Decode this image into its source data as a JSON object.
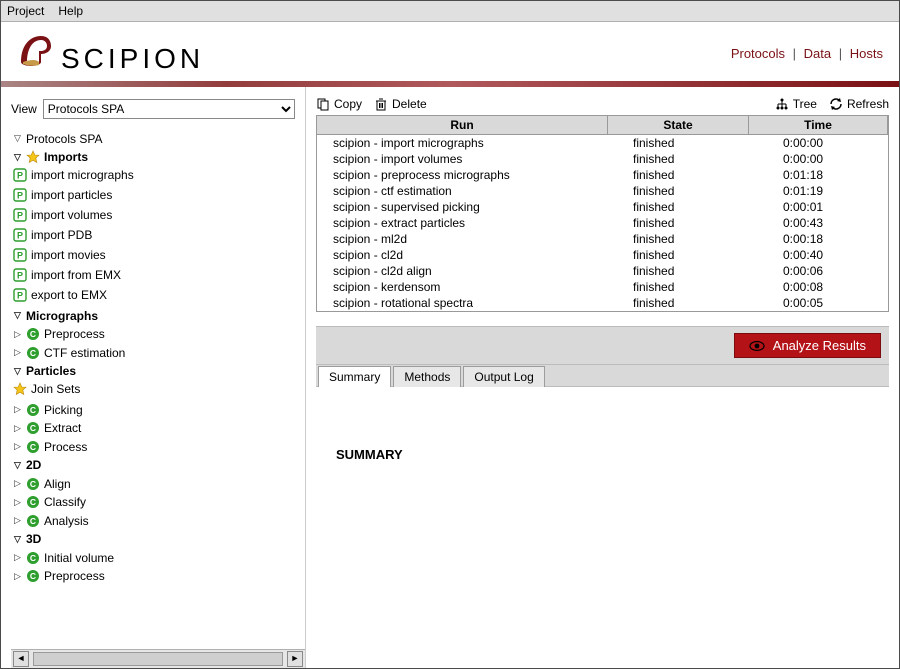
{
  "menu": {
    "project": "Project",
    "help": "Help"
  },
  "brand": "SCIPION",
  "header_links": {
    "protocols": "Protocols",
    "data": "Data",
    "hosts": "Hosts"
  },
  "view_label": "View",
  "view_value": "Protocols SPA",
  "tree": {
    "root": "Protocols SPA",
    "imports": {
      "label": "Imports",
      "items": [
        "import micrographs",
        "import particles",
        "import volumes",
        "import PDB",
        "import movies",
        "import from EMX",
        "export to EMX"
      ]
    },
    "micrographs": {
      "label": "Micrographs",
      "items": [
        "Preprocess",
        "CTF estimation"
      ]
    },
    "particles": {
      "label": "Particles",
      "join": "Join Sets",
      "items": [
        "Picking",
        "Extract",
        "Process"
      ]
    },
    "two_d": {
      "label": "2D",
      "items": [
        "Align",
        "Classify",
        "Analysis"
      ]
    },
    "three_d": {
      "label": "3D",
      "items": [
        "Initial volume",
        "Preprocess"
      ]
    }
  },
  "toolbar": {
    "copy": "Copy",
    "delete": "Delete",
    "tree": "Tree",
    "refresh": "Refresh"
  },
  "table": {
    "headers": {
      "run": "Run",
      "state": "State",
      "time": "Time"
    },
    "rows": [
      {
        "run": "scipion - import micrographs",
        "state": "finished",
        "time": "0:00:00"
      },
      {
        "run": "scipion - import volumes",
        "state": "finished",
        "time": "0:00:00"
      },
      {
        "run": "scipion - preprocess micrographs",
        "state": "finished",
        "time": "0:01:18"
      },
      {
        "run": "scipion - ctf estimation",
        "state": "finished",
        "time": "0:01:19"
      },
      {
        "run": "scipion - supervised picking",
        "state": "finished",
        "time": "0:00:01"
      },
      {
        "run": "scipion - extract particles",
        "state": "finished",
        "time": "0:00:43"
      },
      {
        "run": "scipion - ml2d",
        "state": "finished",
        "time": "0:00:18"
      },
      {
        "run": "scipion - cl2d",
        "state": "finished",
        "time": "0:00:40"
      },
      {
        "run": "scipion - cl2d align",
        "state": "finished",
        "time": "0:00:06"
      },
      {
        "run": "scipion - kerdensom",
        "state": "finished",
        "time": "0:00:08"
      },
      {
        "run": "scipion - rotational spectra",
        "state": "finished",
        "time": "0:00:05"
      }
    ]
  },
  "analyze_label": "Analyze Results",
  "tabs": {
    "summary": "Summary",
    "methods": "Methods",
    "output": "Output Log"
  },
  "summary_title": "SUMMARY"
}
